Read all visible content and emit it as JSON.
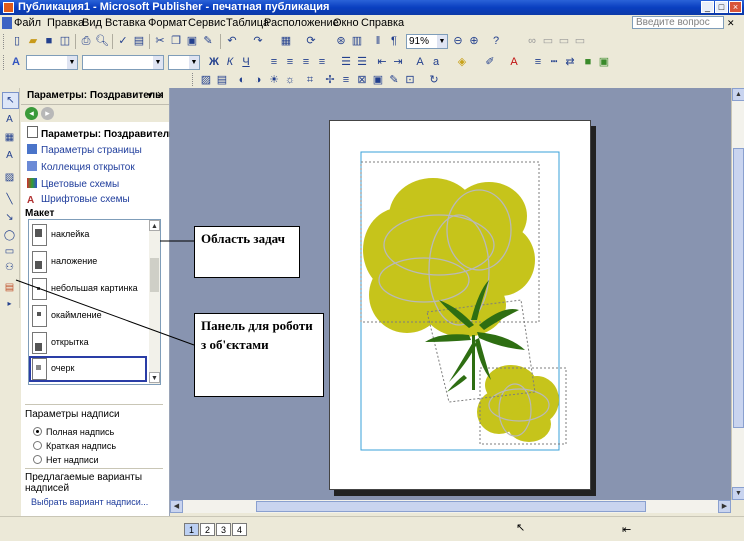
{
  "window": {
    "title": "Публикация1 - Microsoft Publisher - печатная публикация",
    "min": "_",
    "max": "□",
    "close": "×"
  },
  "menu": [
    "Файл",
    "Правка",
    "Вид",
    "Вставка",
    "Формат",
    "Сервис",
    "Таблица",
    "Расположение",
    "Окно",
    "Справка"
  ],
  "help_placeholder": "Введите вопрос",
  "toolbar": {
    "zoom": "91%"
  },
  "taskpane": {
    "header": "Параметры: Поздравителы",
    "selected_title": "Параметры: Поздравительна",
    "links": [
      "Параметры страницы",
      "Коллекция открыток",
      "Цветовые схемы",
      "Шрифтовые схемы"
    ],
    "layout_label": "Макет",
    "layouts": [
      "наклейка",
      "наложение",
      "небольшая картинка",
      "окаймление",
      "открытка",
      "очерк"
    ],
    "caption_label": "Параметры надписи",
    "caption_options": [
      {
        "label": "Полная надпись",
        "selected": true
      },
      {
        "label": "Краткая надпись",
        "selected": false
      },
      {
        "label": "Нет надписи",
        "selected": false
      }
    ],
    "suggested_label": "Предлагаемые варианты надписей",
    "suggested_link": "Выбрать вариант надписи..."
  },
  "callouts": {
    "taskpane": "Область задач",
    "objects": "Панель для роботи з об'єктами"
  },
  "pages": [
    "1",
    "2",
    "3",
    "4"
  ],
  "colors": {
    "flower": "#c6c41b",
    "leaves": "#2e6e12",
    "workspace": "#8894b0"
  }
}
